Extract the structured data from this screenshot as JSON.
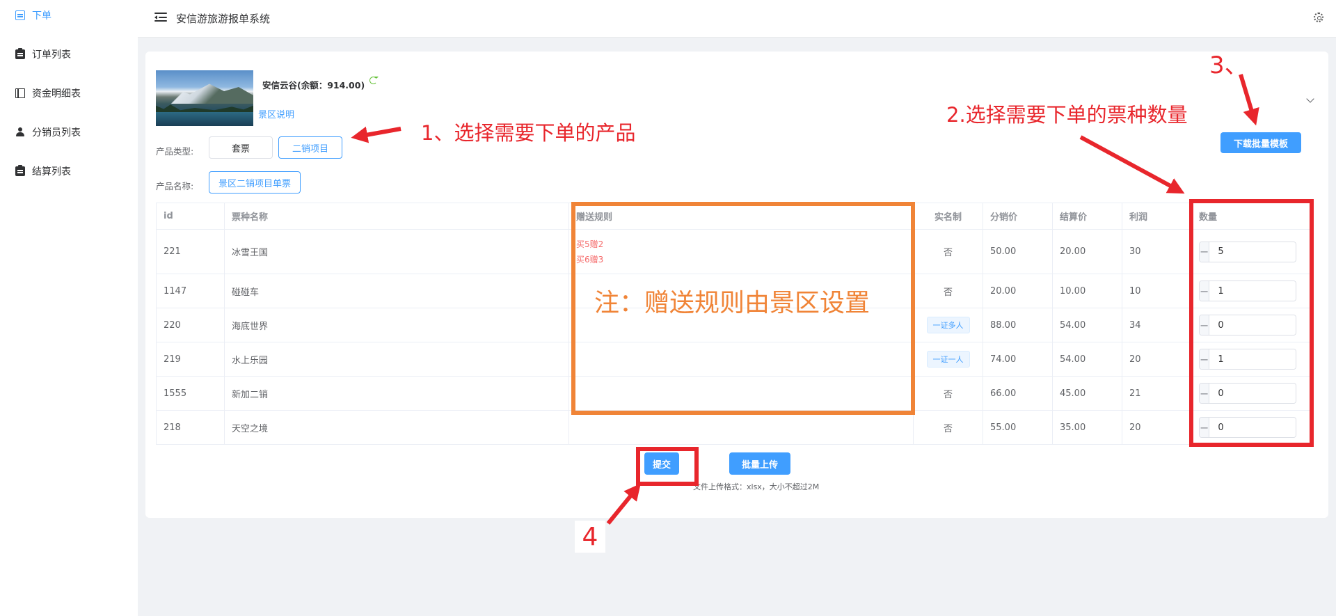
{
  "sidebar": {
    "items": [
      {
        "label": "下单",
        "icon": "document-icon",
        "active": true
      },
      {
        "label": "订单列表",
        "icon": "clipboard-icon",
        "active": false
      },
      {
        "label": "资金明细表",
        "icon": "book-icon",
        "active": false
      },
      {
        "label": "分销员列表",
        "icon": "user-icon",
        "active": false
      },
      {
        "label": "结算列表",
        "icon": "clipboard-icon",
        "active": false
      }
    ]
  },
  "header": {
    "title": "安信游旅游报单系统"
  },
  "product": {
    "merchant": "安信云谷(余额：914.00)",
    "scenic_link": "景区说明",
    "type_label": "产品类型:",
    "type_options": [
      "套票",
      "二销项目"
    ],
    "selected_type": "二销项目",
    "name_label": "产品名称:",
    "selected_name": "景区二销项目单票",
    "download_button": "下载批量模板"
  },
  "table": {
    "headers": {
      "id": "id",
      "name": "票种名称",
      "rules": "赠送规则",
      "realname": "实名制",
      "price": "分销价",
      "settle": "结算价",
      "profit": "利润",
      "qty": "数量"
    },
    "rows": [
      {
        "id": "221",
        "name": "冰雪王国",
        "rules": [
          "买5赠2",
          "买6赠3"
        ],
        "realname": "否",
        "realname_tag": false,
        "price": "50.00",
        "settle": "20.00",
        "profit": "30",
        "qty": "5"
      },
      {
        "id": "1147",
        "name": "碰碰车",
        "rules": [],
        "realname": "否",
        "realname_tag": false,
        "price": "20.00",
        "settle": "10.00",
        "profit": "10",
        "qty": "1"
      },
      {
        "id": "220",
        "name": "海底世界",
        "rules": [],
        "realname": "一证多人",
        "realname_tag": true,
        "price": "88.00",
        "settle": "54.00",
        "profit": "34",
        "qty": "0"
      },
      {
        "id": "219",
        "name": "水上乐园",
        "rules": [],
        "realname": "一证一人",
        "realname_tag": true,
        "price": "74.00",
        "settle": "54.00",
        "profit": "20",
        "qty": "1"
      },
      {
        "id": "1555",
        "name": "新加二销",
        "rules": [],
        "realname": "否",
        "realname_tag": false,
        "price": "66.00",
        "settle": "45.00",
        "profit": "21",
        "qty": "0"
      },
      {
        "id": "218",
        "name": "天空之境",
        "rules": [],
        "realname": "否",
        "realname_tag": false,
        "price": "55.00",
        "settle": "35.00",
        "profit": "20",
        "qty": "0"
      }
    ]
  },
  "actions": {
    "submit": "提交",
    "batch_upload": "批量上传",
    "upload_hint": "文件上传格式：xlsx，大小不超过2M"
  },
  "annotations": {
    "step1": "1、选择需要下单的产品",
    "step2": "2.选择需要下单的票种数量",
    "step3": "3、",
    "step4": "4",
    "note": "注：赠送规则由景区设置",
    "red": "#e8262c",
    "orange": "#f08437"
  }
}
